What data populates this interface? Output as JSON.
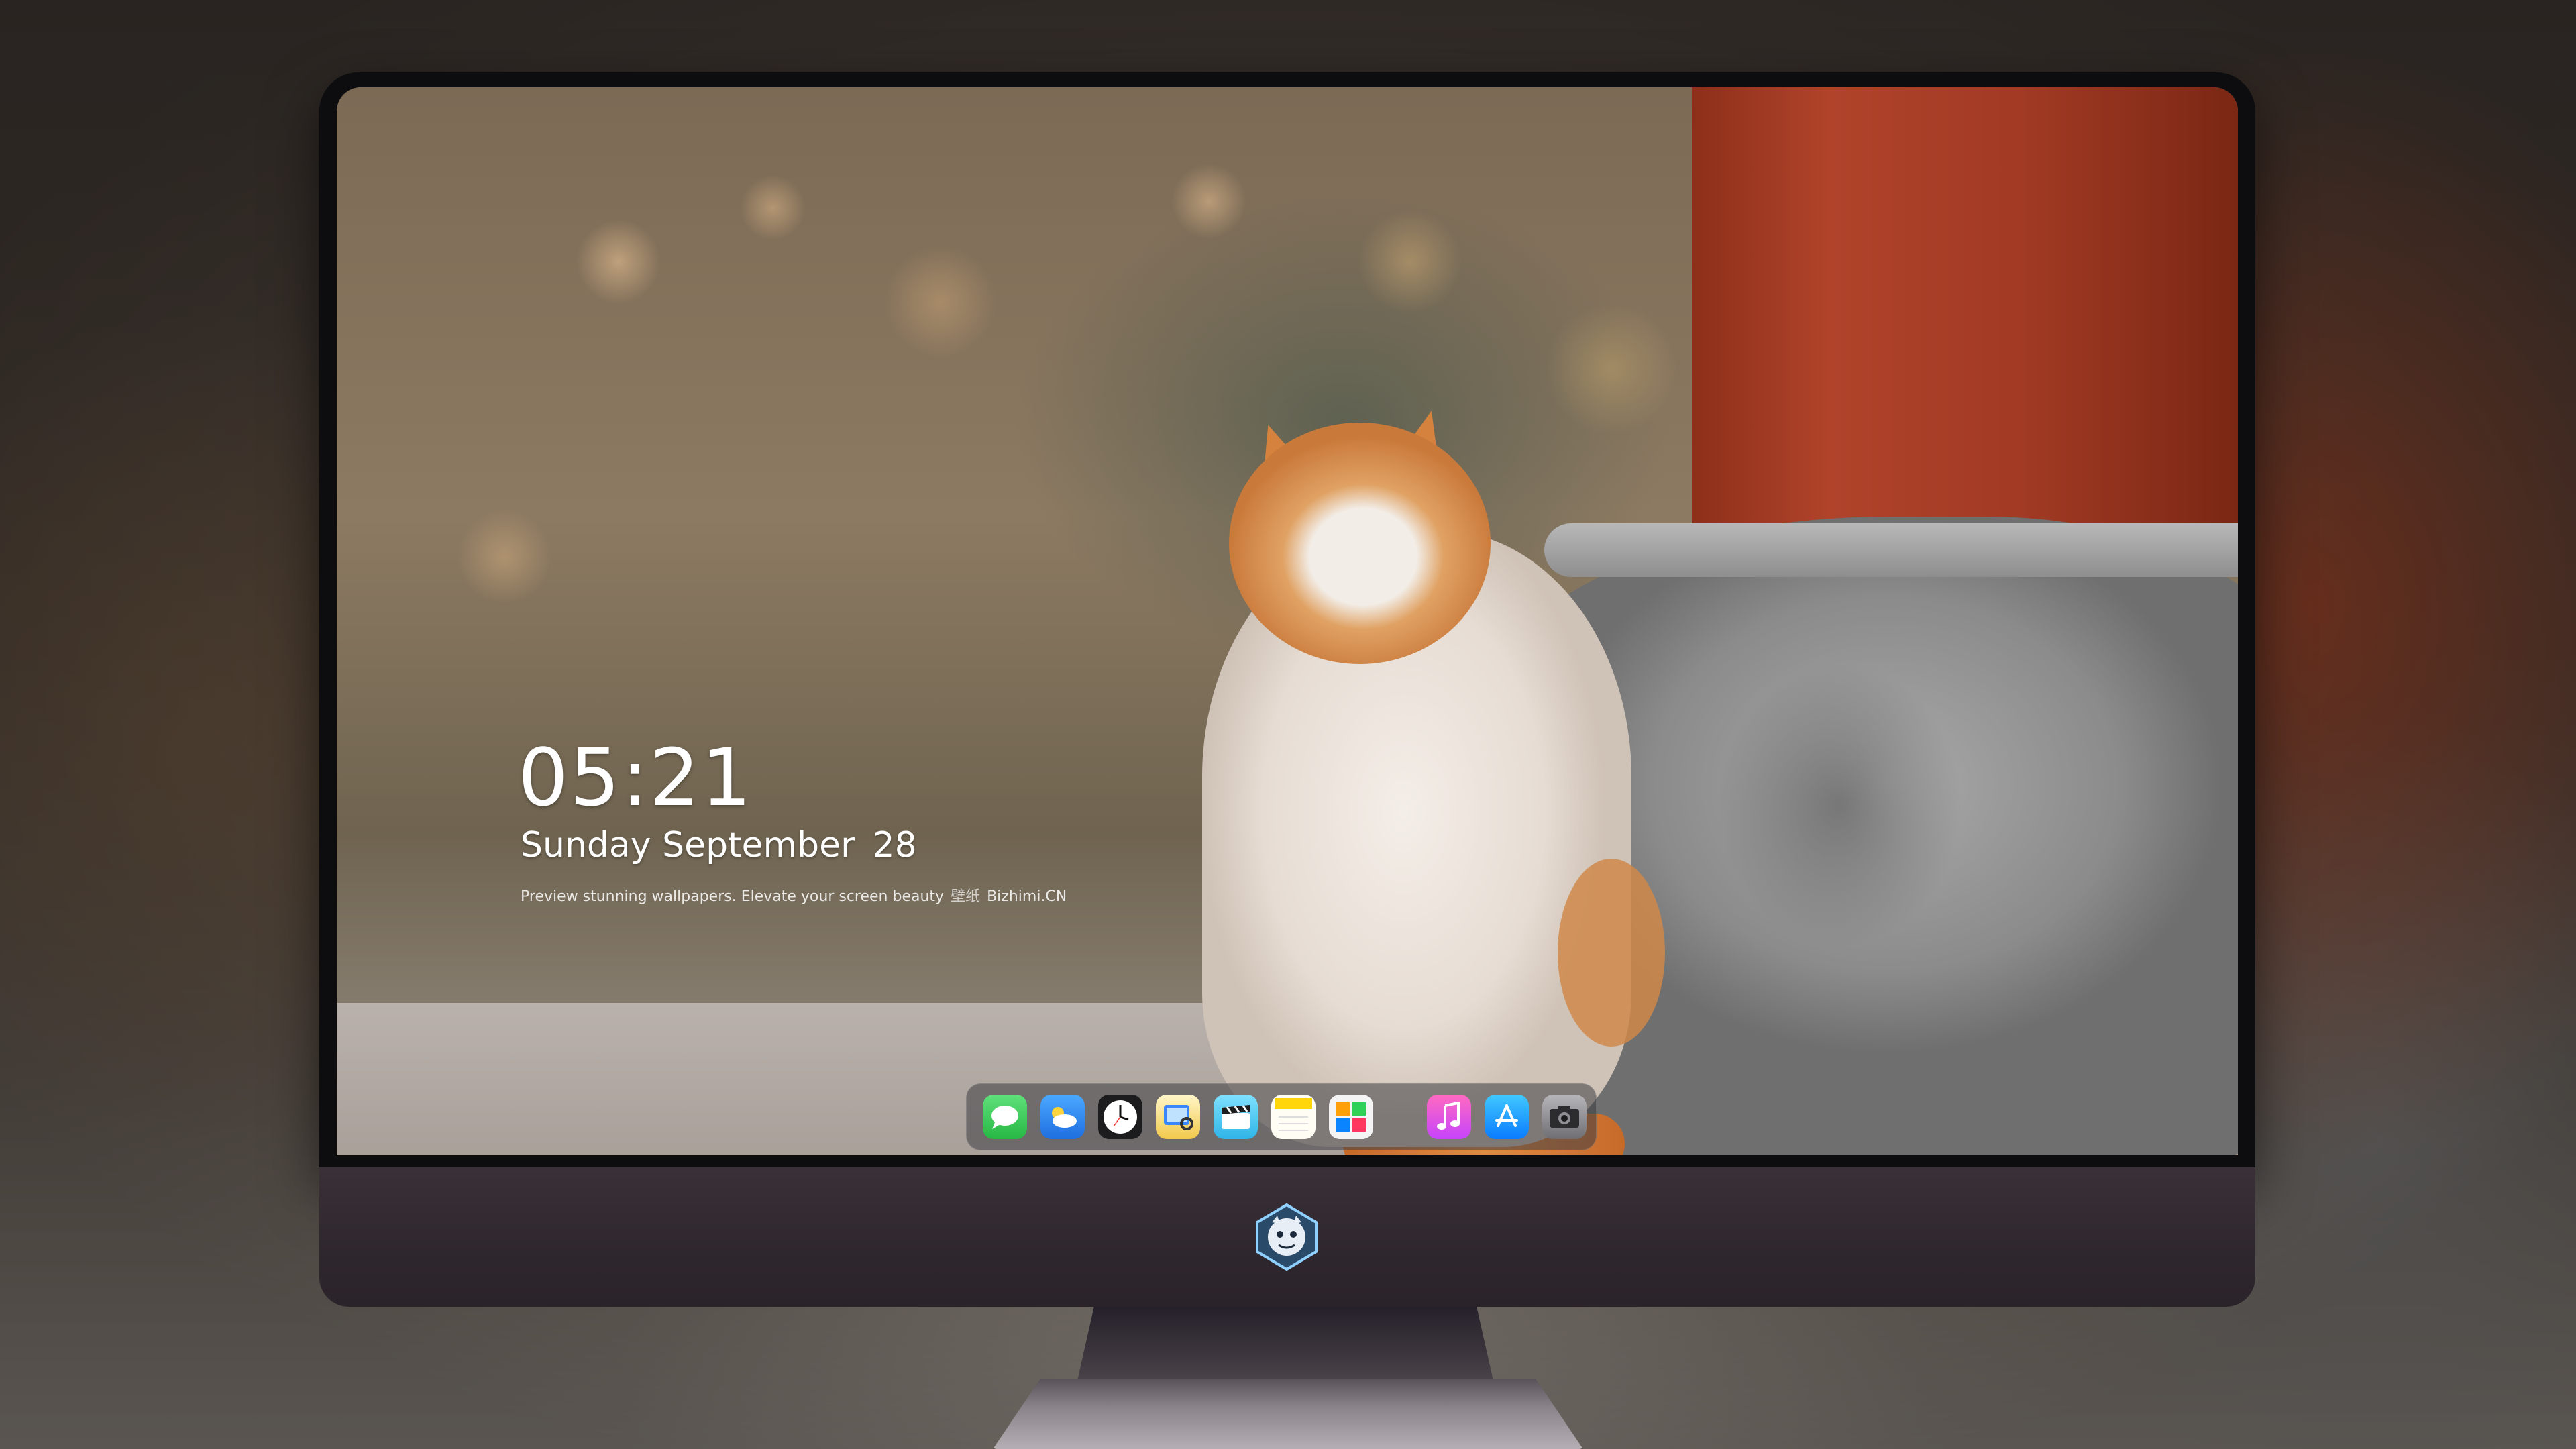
{
  "lock_screen": {
    "time": "05:21",
    "date_text": "Sunday September",
    "day": "28",
    "caption_text": "Preview stunning wallpapers. Elevate your screen beauty",
    "caption_faded": "壁纸",
    "caption_site": "Bizhimi.CN"
  },
  "dock": {
    "apps": [
      {
        "name": "messages",
        "icon": "messages-icon",
        "color": "#34c759"
      },
      {
        "name": "weather",
        "icon": "weather-icon",
        "color": "#2f8cf0"
      },
      {
        "name": "clock",
        "icon": "clock-icon",
        "color": "#1c1c1e"
      },
      {
        "name": "preview",
        "icon": "preview-icon",
        "color": "#f2c94c"
      },
      {
        "name": "clips",
        "icon": "clapperboard-icon",
        "color": "#5ac8fa"
      },
      {
        "name": "notes",
        "icon": "notes-icon",
        "color": "#ffd60a"
      },
      {
        "name": "photo-booth",
        "icon": "photo-grid-icon",
        "color": "#ff9f0a"
      },
      {
        "name": "music",
        "icon": "music-icon",
        "color": "#ff2d92"
      },
      {
        "name": "app-store",
        "icon": "app-store-icon",
        "color": "#0a84ff"
      },
      {
        "name": "camera",
        "icon": "camera-icon",
        "color": "#8e8e93"
      }
    ]
  },
  "colors": {
    "bezel": "#0d0d0f",
    "chin": "#2f272e",
    "pillar": "#b0432a"
  }
}
